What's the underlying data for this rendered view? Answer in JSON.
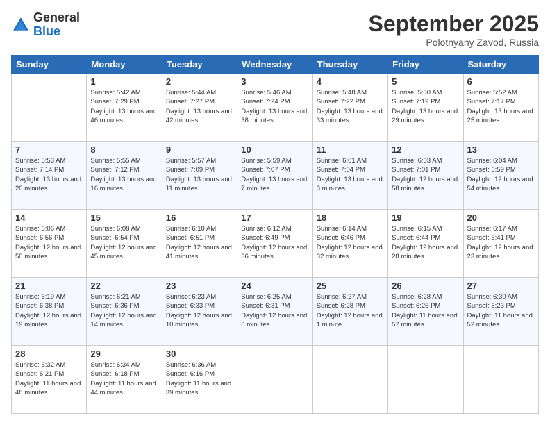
{
  "header": {
    "logo": {
      "general": "General",
      "blue": "Blue"
    },
    "title": "September 2025",
    "location": "Polotnyany Zavod, Russia"
  },
  "weekdays": [
    "Sunday",
    "Monday",
    "Tuesday",
    "Wednesday",
    "Thursday",
    "Friday",
    "Saturday"
  ],
  "weeks": [
    [
      null,
      {
        "day": "1",
        "sunrise": "5:42 AM",
        "sunset": "7:29 PM",
        "daylight": "13 hours and 46 minutes."
      },
      {
        "day": "2",
        "sunrise": "5:44 AM",
        "sunset": "7:27 PM",
        "daylight": "13 hours and 42 minutes."
      },
      {
        "day": "3",
        "sunrise": "5:46 AM",
        "sunset": "7:24 PM",
        "daylight": "13 hours and 38 minutes."
      },
      {
        "day": "4",
        "sunrise": "5:48 AM",
        "sunset": "7:22 PM",
        "daylight": "13 hours and 33 minutes."
      },
      {
        "day": "5",
        "sunrise": "5:50 AM",
        "sunset": "7:19 PM",
        "daylight": "13 hours and 29 minutes."
      },
      {
        "day": "6",
        "sunrise": "5:52 AM",
        "sunset": "7:17 PM",
        "daylight": "13 hours and 25 minutes."
      }
    ],
    [
      {
        "day": "7",
        "sunrise": "5:53 AM",
        "sunset": "7:14 PM",
        "daylight": "13 hours and 20 minutes."
      },
      {
        "day": "8",
        "sunrise": "5:55 AM",
        "sunset": "7:12 PM",
        "daylight": "13 hours and 16 minutes."
      },
      {
        "day": "9",
        "sunrise": "5:57 AM",
        "sunset": "7:09 PM",
        "daylight": "13 hours and 11 minutes."
      },
      {
        "day": "10",
        "sunrise": "5:59 AM",
        "sunset": "7:07 PM",
        "daylight": "13 hours and 7 minutes."
      },
      {
        "day": "11",
        "sunrise": "6:01 AM",
        "sunset": "7:04 PM",
        "daylight": "13 hours and 3 minutes."
      },
      {
        "day": "12",
        "sunrise": "6:03 AM",
        "sunset": "7:01 PM",
        "daylight": "12 hours and 58 minutes."
      },
      {
        "day": "13",
        "sunrise": "6:04 AM",
        "sunset": "6:59 PM",
        "daylight": "12 hours and 54 minutes."
      }
    ],
    [
      {
        "day": "14",
        "sunrise": "6:06 AM",
        "sunset": "6:56 PM",
        "daylight": "12 hours and 50 minutes."
      },
      {
        "day": "15",
        "sunrise": "6:08 AM",
        "sunset": "6:54 PM",
        "daylight": "12 hours and 45 minutes."
      },
      {
        "day": "16",
        "sunrise": "6:10 AM",
        "sunset": "6:51 PM",
        "daylight": "12 hours and 41 minutes."
      },
      {
        "day": "17",
        "sunrise": "6:12 AM",
        "sunset": "6:49 PM",
        "daylight": "12 hours and 36 minutes."
      },
      {
        "day": "18",
        "sunrise": "6:14 AM",
        "sunset": "6:46 PM",
        "daylight": "12 hours and 32 minutes."
      },
      {
        "day": "19",
        "sunrise": "6:15 AM",
        "sunset": "6:44 PM",
        "daylight": "12 hours and 28 minutes."
      },
      {
        "day": "20",
        "sunrise": "6:17 AM",
        "sunset": "6:41 PM",
        "daylight": "12 hours and 23 minutes."
      }
    ],
    [
      {
        "day": "21",
        "sunrise": "6:19 AM",
        "sunset": "6:38 PM",
        "daylight": "12 hours and 19 minutes."
      },
      {
        "day": "22",
        "sunrise": "6:21 AM",
        "sunset": "6:36 PM",
        "daylight": "12 hours and 14 minutes."
      },
      {
        "day": "23",
        "sunrise": "6:23 AM",
        "sunset": "6:33 PM",
        "daylight": "12 hours and 10 minutes."
      },
      {
        "day": "24",
        "sunrise": "6:25 AM",
        "sunset": "6:31 PM",
        "daylight": "12 hours and 6 minutes."
      },
      {
        "day": "25",
        "sunrise": "6:27 AM",
        "sunset": "6:28 PM",
        "daylight": "12 hours and 1 minute."
      },
      {
        "day": "26",
        "sunrise": "6:28 AM",
        "sunset": "6:26 PM",
        "daylight": "11 hours and 57 minutes."
      },
      {
        "day": "27",
        "sunrise": "6:30 AM",
        "sunset": "6:23 PM",
        "daylight": "11 hours and 52 minutes."
      }
    ],
    [
      {
        "day": "28",
        "sunrise": "6:32 AM",
        "sunset": "6:21 PM",
        "daylight": "11 hours and 48 minutes."
      },
      {
        "day": "29",
        "sunrise": "6:34 AM",
        "sunset": "6:18 PM",
        "daylight": "11 hours and 44 minutes."
      },
      {
        "day": "30",
        "sunrise": "6:36 AM",
        "sunset": "6:16 PM",
        "daylight": "11 hours and 39 minutes."
      },
      null,
      null,
      null,
      null
    ]
  ]
}
